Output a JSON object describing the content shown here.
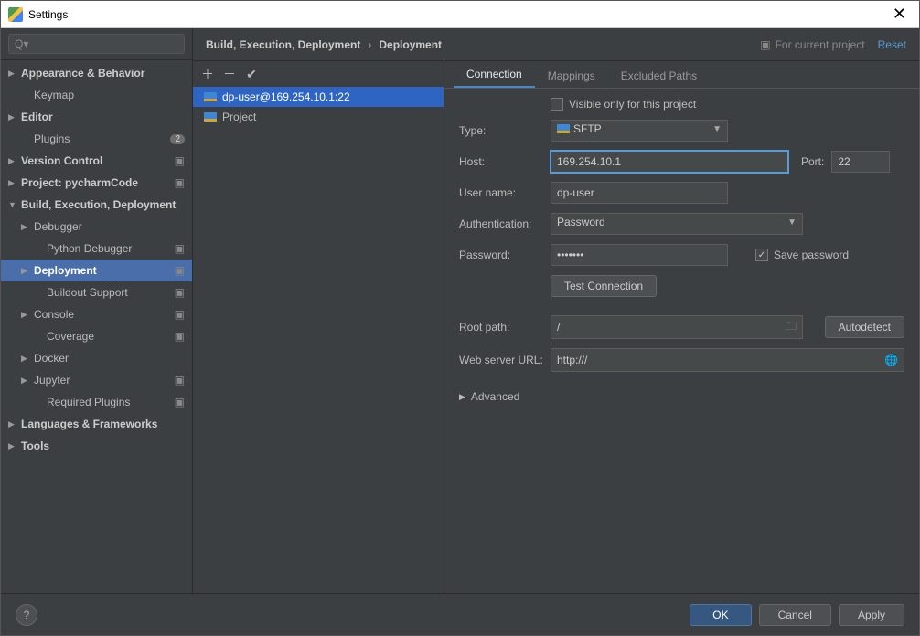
{
  "titlebar": {
    "title": "Settings"
  },
  "search": {
    "placeholder": "Q▾"
  },
  "sidebar": [
    {
      "label": "Appearance & Behavior",
      "arrow": "collapsed",
      "lvl": 0
    },
    {
      "label": "Keymap",
      "arrow": "none",
      "lvl": 1
    },
    {
      "label": "Editor",
      "arrow": "collapsed",
      "lvl": 0
    },
    {
      "label": "Plugins",
      "arrow": "none",
      "lvl": 1,
      "badge_count": "2"
    },
    {
      "label": "Version Control",
      "arrow": "collapsed",
      "lvl": 0,
      "badge_icon": true
    },
    {
      "label": "Project: pycharmCode",
      "arrow": "collapsed",
      "lvl": 0,
      "badge_icon": true
    },
    {
      "label": "Build, Execution, Deployment",
      "arrow": "expanded",
      "lvl": 0,
      "bold": true
    },
    {
      "label": "Debugger",
      "arrow": "collapsed",
      "lvl": 1
    },
    {
      "label": "Python Debugger",
      "arrow": "none",
      "lvl": 2,
      "badge_icon": true
    },
    {
      "label": "Deployment",
      "arrow": "collapsed",
      "lvl": 1,
      "selected": true,
      "badge_icon": true
    },
    {
      "label": "Buildout Support",
      "arrow": "none",
      "lvl": 2,
      "badge_icon": true
    },
    {
      "label": "Console",
      "arrow": "collapsed",
      "lvl": 1,
      "badge_icon": true
    },
    {
      "label": "Coverage",
      "arrow": "none",
      "lvl": 2,
      "badge_icon": true
    },
    {
      "label": "Docker",
      "arrow": "collapsed",
      "lvl": 1
    },
    {
      "label": "Jupyter",
      "arrow": "collapsed",
      "lvl": 1,
      "badge_icon": true
    },
    {
      "label": "Required Plugins",
      "arrow": "none",
      "lvl": 2,
      "badge_icon": true
    },
    {
      "label": "Languages & Frameworks",
      "arrow": "collapsed",
      "lvl": 0
    },
    {
      "label": "Tools",
      "arrow": "collapsed",
      "lvl": 0
    }
  ],
  "crumbs": {
    "a": "Build, Execution, Deployment",
    "b": "Deployment"
  },
  "for_project": "For current project",
  "reset": "Reset",
  "servers": [
    {
      "label": "dp-user@169.254.10.1:22",
      "selected": true
    },
    {
      "label": "Project",
      "selected": false
    }
  ],
  "tabs": [
    {
      "label": "Connection",
      "active": true
    },
    {
      "label": "Mappings",
      "active": false
    },
    {
      "label": "Excluded Paths",
      "active": false
    }
  ],
  "form": {
    "visible_only": "Visible only for this project",
    "type_label": "Type:",
    "type_value": "SFTP",
    "host_label": "Host:",
    "host_value": "169.254.10.1",
    "port_label": "Port:",
    "port_value": "22",
    "user_label": "User name:",
    "user_value": "dp-user",
    "auth_label": "Authentication:",
    "auth_value": "Password",
    "pass_label": "Password:",
    "pass_value": "•••••••",
    "save_pass": "Save password",
    "test_btn": "Test Connection",
    "root_label": "Root path:",
    "root_value": "/",
    "autodetect": "Autodetect",
    "web_label": "Web server URL:",
    "web_value": "http:///",
    "advanced": "Advanced"
  },
  "footer": {
    "ok": "OK",
    "cancel": "Cancel",
    "apply": "Apply"
  }
}
